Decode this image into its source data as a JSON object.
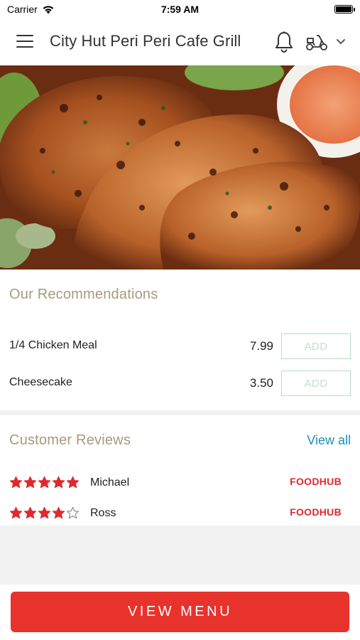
{
  "status_bar": {
    "carrier": "Carrier",
    "time": "7:59 AM"
  },
  "header": {
    "title": "City Hut Peri Peri Cafe Grill",
    "icons": [
      "hamburger-menu-icon",
      "bell-icon",
      "scooter-icon",
      "chevron-down-icon"
    ]
  },
  "hero": {
    "description_icon": "grilled-chicken-photo"
  },
  "recommendations": {
    "title": "Our Recommendations",
    "items": [
      {
        "name": "1/4 Chicken Meal",
        "price": "7.99",
        "button": "ADD"
      },
      {
        "name": "Cheesecake",
        "price": "3.50",
        "button": "ADD"
      }
    ]
  },
  "reviews": {
    "title": "Customer Reviews",
    "view_all": "View all",
    "items": [
      {
        "reviewer": "Michael",
        "rating": 5,
        "source": "FOODHUB"
      },
      {
        "reviewer": "Ross",
        "rating": 4,
        "source": "FOODHUB"
      }
    ]
  },
  "footer": {
    "view_menu": "VIEW MENU"
  },
  "colors": {
    "accent_red": "#e8322c",
    "section_title": "#a99a7a",
    "link_blue": "#1b8fb8",
    "add_border": "#b6ddc5",
    "star_red": "#e0282e"
  }
}
